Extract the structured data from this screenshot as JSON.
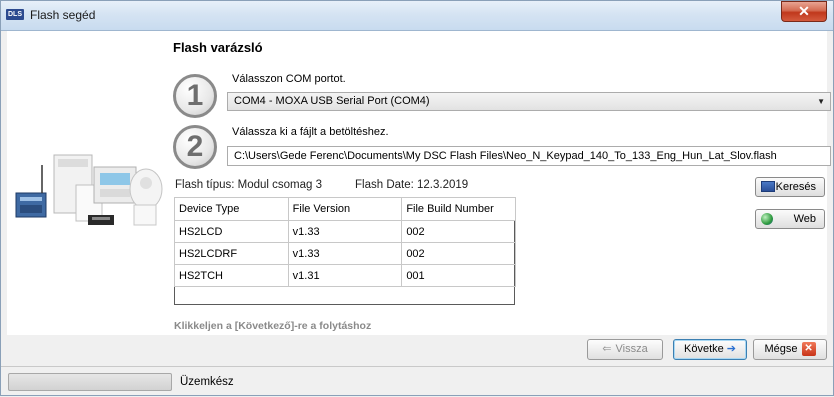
{
  "window": {
    "title": "Flash segéd",
    "app_icon_text": "DLS",
    "close_symbol": "✕",
    "icons": {
      "app": "dls-app-icon",
      "close": "close-icon"
    }
  },
  "wizard": {
    "heading": "Flash varázsló",
    "step1": {
      "number": "1",
      "label": "Válasszon COM portot.",
      "selected_port": "COM4 - MOXA USB Serial Port (COM4)"
    },
    "step2": {
      "number": "2",
      "label": "Válassza ki a fájlt a betöltéshez.",
      "file_path": "C:\\Users\\Gede Ferenc\\Documents\\My DSC Flash Files\\Neo_N_Keypad_140_To_133_Eng_Hun_Lat_Slov.flash"
    },
    "flash_type": "Flash típus: Modul csomag 3",
    "flash_date": "Flash Date: 12.3.2019",
    "table": {
      "headers": [
        "Device Type",
        "File Version",
        "File Build Number"
      ],
      "rows": [
        [
          "HS2LCD",
          "v1.33",
          "002"
        ],
        [
          "HS2LCDRF",
          "v1.33",
          "002"
        ],
        [
          "HS2TCH",
          "v1.31",
          "001"
        ]
      ]
    },
    "buttons": {
      "search": "Keresés",
      "web": "Web"
    },
    "hint": "Klikkeljen a [Következő]-re a folytáshoz"
  },
  "navigation": {
    "back": "Vissza",
    "next": "Követke",
    "cancel": "Mégse"
  },
  "status": {
    "text": "Üzemkész"
  }
}
